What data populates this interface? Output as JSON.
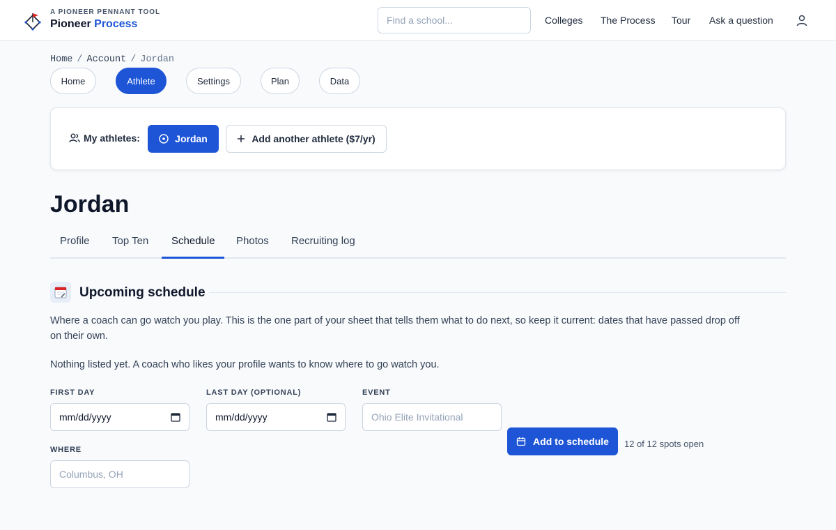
{
  "brand": {
    "tagline": "A PIONEER PENNANT TOOL",
    "name_main": "Pioneer",
    "name_accent": "Process",
    "accent_color": "#1d55d6"
  },
  "search": {
    "placeholder": "Find a school..."
  },
  "nav": [
    "Colleges",
    "The Process",
    "Tour",
    "Ask a question"
  ],
  "breadcrumb": {
    "home": "Home",
    "account": "Account",
    "current": "Jordan"
  },
  "pills": [
    "Home",
    "Athlete",
    "Settings",
    "Plan",
    "Data"
  ],
  "athletes": {
    "label": "My athletes:",
    "selected": "Jordan",
    "add_label": "Add another athlete ($7/yr)"
  },
  "page_title": "Jordan",
  "tabs": [
    "Profile",
    "Top Ten",
    "Schedule",
    "Photos",
    "Recruiting log"
  ],
  "section": {
    "title": "Upcoming schedule",
    "description": "Where a coach can go watch you play. This is the one part of your sheet that tells them what to do next, so keep it current: dates that have passed drop off on their own.",
    "empty_note": "Nothing listed yet. A coach who likes your profile wants to know where to go watch you."
  },
  "form": {
    "first_day_label": "FIRST DAY",
    "first_day_value": "mm/dd/yyyy",
    "last_day_label": "LAST DAY (OPTIONAL)",
    "last_day_value": "mm/dd/yyyy",
    "event_label": "EVENT",
    "event_placeholder": "Ohio Elite Invitational",
    "where_label": "WHERE",
    "where_placeholder": "Columbus, OH",
    "add_button": "Add to schedule",
    "spots_text": "12 of 12 spots open"
  },
  "icons": [
    "pennant-logo",
    "user-icon",
    "users-icon",
    "radio-circle-icon",
    "plus-icon",
    "calendar-emoji-icon",
    "calendar-icon"
  ]
}
